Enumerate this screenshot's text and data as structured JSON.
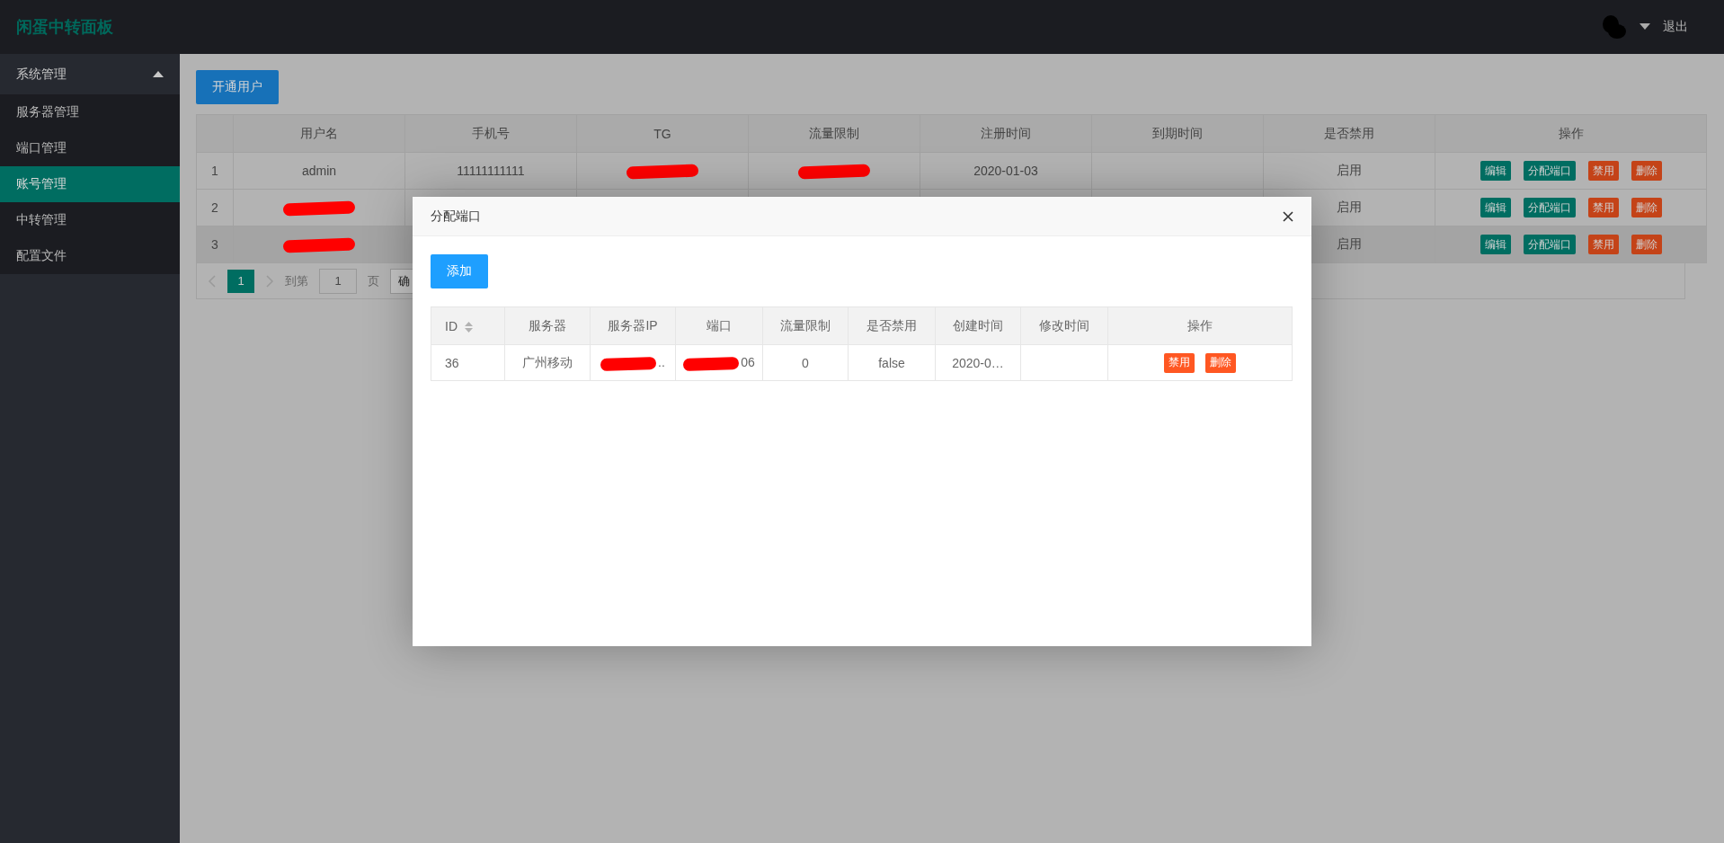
{
  "header": {
    "title": "闲蛋中转面板",
    "logout": "退出"
  },
  "sidebar": {
    "group": {
      "label": "系统管理",
      "expanded": true
    },
    "items": [
      {
        "label": "服务器管理",
        "selected": false
      },
      {
        "label": "端口管理",
        "selected": false
      },
      {
        "label": "账号管理",
        "selected": true
      },
      {
        "label": "中转管理",
        "selected": false
      },
      {
        "label": "配置文件",
        "selected": false
      }
    ]
  },
  "main": {
    "open_user_button": "开通用户",
    "table": {
      "columns": [
        "",
        "用户名",
        "手机号",
        "TG",
        "流量限制",
        "注册时间",
        "到期时间",
        "是否禁用",
        "操作"
      ],
      "rows": [
        {
          "index": "1",
          "username": "admin",
          "phone": "11111111111",
          "tg": {
            "redacted": true
          },
          "traffic": {
            "redacted": true
          },
          "registered": "2020-01-03",
          "status": "启用",
          "actions": [
            {
              "label": "编辑",
              "kind": "primary"
            },
            {
              "label": "分配端口",
              "kind": "primary"
            },
            {
              "label": "禁用",
              "kind": "danger"
            },
            {
              "label": "删除",
              "kind": "danger"
            }
          ],
          "hovered": false
        },
        {
          "index": "2",
          "username": {
            "redacted": true
          },
          "status": "启用",
          "actions": [
            {
              "label": "编辑",
              "kind": "primary"
            },
            {
              "label": "分配端口",
              "kind": "primary"
            },
            {
              "label": "禁用",
              "kind": "danger"
            },
            {
              "label": "删除",
              "kind": "danger"
            }
          ],
          "hovered": false
        },
        {
          "index": "3",
          "username": {
            "redacted": true
          },
          "status": "启用",
          "actions": [
            {
              "label": "编辑",
              "kind": "primary"
            },
            {
              "label": "分配端口",
              "kind": "primary"
            },
            {
              "label": "禁用",
              "kind": "danger"
            },
            {
              "label": "删除",
              "kind": "danger"
            }
          ],
          "hovered": true
        }
      ]
    },
    "pagination": {
      "pages": [
        {
          "label": "1",
          "selected": true
        }
      ],
      "goto_label": "到第",
      "page_input": "1",
      "page_unit": "页",
      "confirm": "确"
    }
  },
  "dialog": {
    "title": "分配端口",
    "add_button": "添加",
    "table": {
      "columns": [
        {
          "label": "ID",
          "sortable": true
        },
        {
          "label": "服务器",
          "sortable": false
        },
        {
          "label": "服务器IP",
          "sortable": false
        },
        {
          "label": "端口",
          "sortable": false
        },
        {
          "label": "流量限制",
          "sortable": false
        },
        {
          "label": "是否禁用",
          "sortable": false
        },
        {
          "label": "创建时间",
          "sortable": false
        },
        {
          "label": "修改时间",
          "sortable": false
        },
        {
          "label": "操作",
          "sortable": false
        }
      ],
      "rows": [
        {
          "cells": [
            "36",
            "广州移动",
            {
              "text": "..",
              "redacted": true
            },
            {
              "text": "06",
              "redacted": true
            },
            "0",
            "false",
            "2020-0…",
            ""
          ],
          "actions": [
            {
              "label": "禁用",
              "kind": "danger"
            },
            {
              "label": "删除",
              "kind": "danger"
            }
          ]
        }
      ]
    }
  }
}
